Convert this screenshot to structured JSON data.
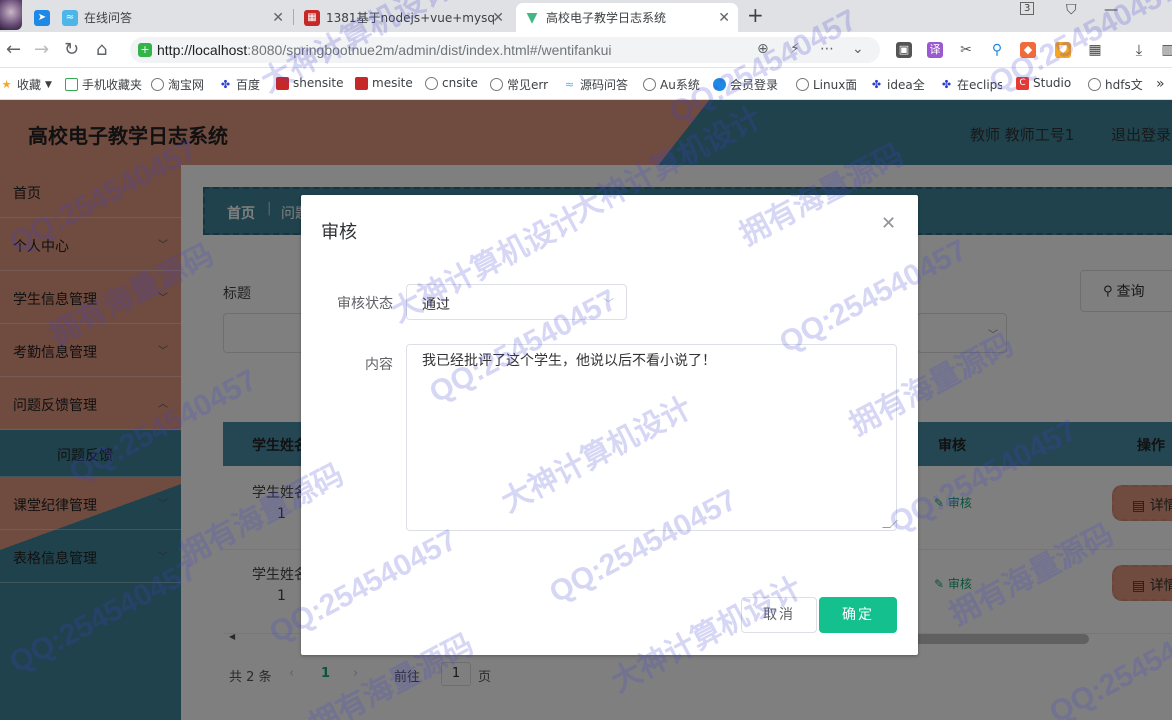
{
  "browser": {
    "tabs": [
      {
        "title": "在线问答",
        "active": false
      },
      {
        "title": "1381基于nodejs+vue+mysq",
        "active": false
      },
      {
        "title": "高校电子教学日志系统",
        "active": true
      }
    ],
    "tab_counter": "3",
    "url_host": "http://localhost",
    "url_rest": ":8080/springbootnue2m/admin/dist/index.html#/wentifankui",
    "bookmarks": [
      "收藏",
      "手机收藏夹",
      "淘宝网",
      "百度",
      "shensite",
      "mesite",
      "cnsite",
      "常见err",
      "源码问答",
      "Au系统",
      "会员登录",
      "Linux面",
      "idea全",
      "在eclips",
      "Studio",
      "hdfs文"
    ]
  },
  "app": {
    "title": "高校电子教学日志系统",
    "user_info": "教师 教师工号1",
    "logout": "退出登录"
  },
  "sidebar": {
    "items": [
      {
        "label": "首页",
        "chevron": false
      },
      {
        "label": "个人中心",
        "chevron": true
      },
      {
        "label": "学生信息管理",
        "chevron": true
      },
      {
        "label": "考勤信息管理",
        "chevron": true
      },
      {
        "label": "问题反馈管理",
        "chevron": true
      },
      {
        "label": "问题反馈",
        "chevron": false,
        "sub": true
      },
      {
        "label": "课堂纪律管理",
        "chevron": true
      },
      {
        "label": "表格信息管理",
        "chevron": true
      }
    ]
  },
  "main": {
    "breadcrumb_home": "首页",
    "breadcrumb_current": "问题",
    "search_label": "标题",
    "query_label": "查询",
    "table": {
      "col_name": "学生姓名",
      "col_audit": "审核",
      "col_action": "操作",
      "rows": [
        {
          "name": "学生姓名",
          "num": "1",
          "audit": "审核",
          "detail": "详情"
        },
        {
          "name": "学生姓名",
          "num": "1",
          "audit": "审核",
          "detail": "详情"
        }
      ]
    },
    "pager": {
      "total": "共 2 条",
      "current": "1",
      "goto": "前往",
      "goto_value": "1",
      "page_unit": "页"
    }
  },
  "dialog": {
    "title": "审核",
    "status_label": "审核状态",
    "status_value": "通过",
    "content_label": "内容",
    "content_value": "我已经批评了这个学生，他说以后不看小说了！",
    "cancel": "取消",
    "confirm": "确定"
  },
  "watermarks": [
    "QQ:254540457",
    "拥有海量源码",
    "大神计算机设计"
  ],
  "colors": {
    "salmon": "#e0967f",
    "teal": "#3e8499",
    "primary": "#13c08e"
  }
}
